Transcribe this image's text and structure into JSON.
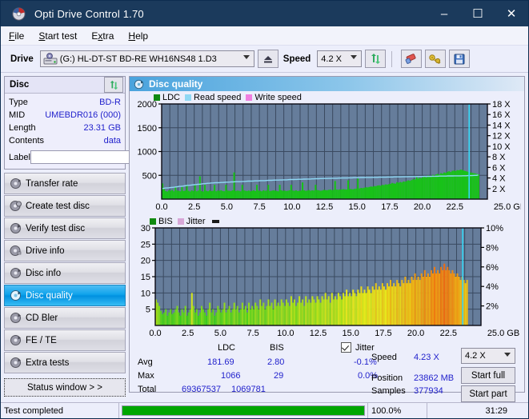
{
  "window": {
    "title": "Opti Drive Control 1.70",
    "icon": "disc-icon",
    "minimize": "–",
    "maximize": "☐",
    "close": "✕",
    "titlebar_color": "#1b3a5c"
  },
  "menu": {
    "items": [
      {
        "label": "File",
        "accel": "F"
      },
      {
        "label": "Start test",
        "accel": "S"
      },
      {
        "label": "Extra",
        "accel": "x"
      },
      {
        "label": "Help",
        "accel": "H"
      }
    ]
  },
  "toolbar": {
    "drive_label": "Drive",
    "drive_value": "(G:)  HL-DT-ST BD-RE  WH16NS48 1.D3",
    "eject_icon": "eject-icon",
    "speed_label": "Speed",
    "speed_value": "4.2 X",
    "refresh_icon": "refresh-icon",
    "erase_icon": "eraser-icon",
    "tools_icon": "key-icon",
    "save_icon": "save-icon"
  },
  "disc": {
    "title": "Disc",
    "refresh_icon": "refresh-icon",
    "rows": [
      {
        "key": "Type",
        "value": "BD-R"
      },
      {
        "key": "MID",
        "value": "UMEBDR016 (000)"
      },
      {
        "key": "Length",
        "value": "23.31 GB"
      },
      {
        "key": "Contents",
        "value": "data"
      }
    ],
    "label_key": "Label",
    "label_value": "",
    "label_placeholder": "",
    "label_button_icon": "cd-icon"
  },
  "nav": {
    "items": [
      {
        "label": "Transfer rate",
        "icon": "disc-icon",
        "selected": false
      },
      {
        "label": "Create test disc",
        "icon": "disc-icon",
        "selected": false
      },
      {
        "label": "Verify test disc",
        "icon": "disc-icon",
        "selected": false
      },
      {
        "label": "Drive info",
        "icon": "disc-icon",
        "selected": false
      },
      {
        "label": "Disc info",
        "icon": "disc-icon",
        "selected": false
      },
      {
        "label": "Disc quality",
        "icon": "disc-icon",
        "selected": true
      },
      {
        "label": "CD Bler",
        "icon": "disc-icon",
        "selected": false
      },
      {
        "label": "FE / TE",
        "icon": "disc-icon",
        "selected": false
      },
      {
        "label": "Extra tests",
        "icon": "disc-icon",
        "selected": false
      }
    ],
    "status_window": "Status window > >"
  },
  "panel": {
    "title": "Disc quality",
    "icon": "disc-icon"
  },
  "stats": {
    "col_ldc": "LDC",
    "col_bis": "BIS",
    "jitter_label": "Jitter",
    "jitter_checked": true,
    "rows": [
      {
        "name": "Avg",
        "ldc": "181.69",
        "bis": "2.80",
        "jitter": "-0.1%"
      },
      {
        "name": "Max",
        "ldc": "1066",
        "bis": "29",
        "jitter": "0.0%"
      },
      {
        "name": "Total",
        "ldc": "69367537",
        "bis": "1069781",
        "jitter": ""
      }
    ],
    "speed_label": "Speed",
    "speed_value": "4.23 X",
    "position_label": "Position",
    "position_value": "23862 MB",
    "samples_label": "Samples",
    "samples_value": "377934",
    "speed_select": "4.2 X",
    "start_full": "Start full",
    "start_part": "Start part"
  },
  "statusbar": {
    "message": "Test completed",
    "progress_text": "100.0%",
    "progress_percent": 100,
    "elapsed": "31:29"
  },
  "chart_data": [
    {
      "type": "area",
      "title": "LDC / Read speed",
      "xlabel": "GB",
      "ylabel": "LDC",
      "xlim": [
        0.0,
        25.0
      ],
      "ylim": [
        0,
        2000
      ],
      "xticks": [
        "0.0",
        "2.5",
        "5.0",
        "7.5",
        "10.0",
        "12.5",
        "15.0",
        "17.5",
        "20.0",
        "22.5",
        "25.0 GB"
      ],
      "yticks": [
        "500",
        "1000",
        "1500",
        "2000"
      ],
      "y2ticks": [
        "2 X",
        "4 X",
        "6 X",
        "8 X",
        "10 X",
        "12 X",
        "14 X",
        "16 X",
        "18 X"
      ],
      "y2lim": [
        0,
        18
      ],
      "grid": true,
      "legend_position": "top-left",
      "legend": [
        {
          "name": "LDC",
          "color": "#18c218"
        },
        {
          "name": "Read speed",
          "color": "#8fd8f4"
        },
        {
          "name": "Write speed",
          "color": "#ef7fe0"
        }
      ],
      "series": [
        {
          "name": "LDC",
          "color": "#18c218",
          "kind": "area",
          "values": [
            330,
            210,
            170,
            160,
            185,
            175,
            195,
            165,
            250,
            180,
            175,
            165,
            255,
            170,
            180,
            300,
            175,
            160,
            185,
            170,
            300,
            165,
            180,
            480,
            170,
            160,
            300,
            175,
            165,
            185,
            170,
            175,
            300,
            165,
            180,
            175,
            185,
            170,
            165,
            300,
            180,
            175,
            170,
            185,
            560,
            170,
            180,
            175,
            165,
            300,
            185,
            175,
            170,
            180,
            165,
            175,
            185,
            170,
            300,
            180,
            175,
            165,
            185,
            175,
            180,
            300,
            170,
            175,
            185,
            180,
            175,
            165,
            300,
            185,
            175,
            180,
            170,
            175,
            185,
            300,
            180,
            175,
            185,
            170,
            175,
            180,
            350,
            185,
            175,
            180,
            190,
            175,
            185,
            180,
            300,
            190,
            185,
            175,
            180,
            195,
            190,
            185,
            195,
            200,
            190,
            195,
            380,
            200,
            195,
            205,
            200,
            210,
            205,
            200,
            395,
            215,
            210,
            205,
            215,
            220,
            430,
            225,
            235,
            230,
            240,
            250,
            245,
            255,
            265,
            260,
            275,
            270,
            285,
            290,
            280,
            300,
            295,
            310,
            305,
            315,
            320,
            340,
            330,
            325,
            355,
            345,
            360,
            350,
            370,
            365,
            380,
            395,
            385,
            400,
            420,
            410,
            470,
            430,
            450,
            440,
            465,
            480,
            455,
            500,
            470,
            490,
            510,
            495,
            520,
            530,
            515,
            545,
            535,
            560,
            550,
            575,
            585,
            570,
            595,
            600,
            590,
            610,
            605,
            620,
            615,
            600,
            590,
            580,
            570,
            560,
            555,
            545,
            540,
            530,
            520,
            0,
            0,
            0,
            0,
            0
          ]
        },
        {
          "name": "Read speed",
          "color": "#8fd8f4",
          "kind": "line",
          "values": [
            2.0,
            2.05,
            2.1,
            2.12,
            2.15,
            2.2,
            2.22,
            2.25,
            2.3,
            2.35,
            2.4,
            2.42,
            2.45,
            2.5,
            2.55,
            2.6,
            2.62,
            2.65,
            2.7,
            2.72,
            2.75,
            2.8,
            2.82,
            2.85,
            2.9,
            2.92,
            2.95,
            3.0,
            3.0,
            3.05,
            3.05,
            3.08,
            3.1,
            3.1,
            3.12,
            3.15,
            3.15,
            3.18,
            3.2,
            3.2,
            3.22,
            3.25,
            3.25,
            3.28,
            3.3,
            3.3,
            3.3,
            3.32,
            3.35,
            3.35,
            3.38,
            3.4,
            3.4,
            3.4,
            3.42,
            3.45,
            3.45,
            3.45,
            3.48,
            3.5,
            3.5,
            3.5,
            3.52,
            3.55,
            3.55,
            3.55,
            3.58,
            3.6,
            3.6,
            3.6,
            3.62,
            3.62,
            3.65,
            3.65,
            3.65,
            3.68,
            3.7,
            3.7,
            3.7,
            3.72,
            3.72,
            3.75,
            3.75,
            3.75,
            3.78,
            3.78,
            3.8,
            3.8,
            3.8,
            3.82,
            3.82,
            3.85,
            3.85,
            3.85,
            3.88,
            3.88,
            3.9,
            3.9,
            3.9,
            3.92,
            3.92,
            3.95,
            3.95,
            3.95,
            3.95,
            3.98,
            3.98,
            4.0,
            4.0,
            4.0,
            4.0,
            4.02,
            4.02,
            4.02,
            4.05,
            4.05,
            4.05,
            4.05,
            4.08,
            4.08,
            4.08,
            4.1,
            4.1,
            4.1,
            4.1,
            4.12,
            4.12,
            4.12,
            4.12,
            4.15,
            4.15,
            4.15,
            4.15,
            4.15,
            4.18,
            4.18,
            4.18,
            4.18,
            4.2,
            4.2,
            4.2,
            4.2,
            4.2,
            4.22,
            4.22,
            4.22,
            4.22,
            4.25,
            4.25,
            4.25,
            4.25,
            4.25,
            4.28,
            4.28,
            4.28,
            4.28,
            4.3,
            4.3,
            4.3,
            4.3,
            4.3,
            4.32,
            4.32,
            4.32,
            4.32,
            4.35,
            4.35,
            4.35,
            4.35,
            4.35,
            4.38,
            4.38,
            4.38,
            4.38,
            4.4,
            4.4,
            4.4,
            4.4,
            4.4,
            4.42,
            4.42,
            4.42,
            4.45,
            4.45,
            4.45,
            4.48,
            4.5,
            4.5,
            4.55,
            0,
            0,
            0,
            0,
            0
          ]
        }
      ],
      "marker_line": {
        "x": 23.6,
        "color": "#35d6f4"
      }
    },
    {
      "type": "area",
      "title": "BIS / Jitter",
      "xlabel": "GB",
      "ylabel": "BIS",
      "xlim": [
        0.0,
        25.0
      ],
      "ylim": [
        0,
        30
      ],
      "xticks": [
        "0.0",
        "2.5",
        "5.0",
        "7.5",
        "10.0",
        "12.5",
        "15.0",
        "17.5",
        "20.0",
        "22.5",
        "25.0 GB"
      ],
      "yticks": [
        "5",
        "10",
        "15",
        "20",
        "25",
        "30"
      ],
      "y2ticks": [
        "2%",
        "4%",
        "6%",
        "8%",
        "10%"
      ],
      "y2lim": [
        0,
        10
      ],
      "grid": true,
      "legend_position": "top-left",
      "legend": [
        {
          "name": "BIS",
          "color": "#18c218"
        },
        {
          "name": "Jitter",
          "color": "#d8a8d8"
        }
      ],
      "series": [
        {
          "name": "BIS",
          "color": "#18c218",
          "kind": "area",
          "values": [
            8,
            7,
            6,
            4.5,
            3.5,
            4,
            5,
            3,
            4,
            5,
            3.5,
            4,
            5,
            6,
            4,
            3,
            5,
            4,
            6,
            3,
            4,
            5,
            10,
            6,
            4,
            5,
            3,
            4,
            6,
            5,
            4,
            3,
            5,
            7,
            4,
            5,
            3,
            4,
            6,
            5,
            4,
            5,
            7,
            4,
            5,
            6,
            4,
            5,
            7,
            5,
            6,
            4,
            5,
            7,
            5,
            6,
            4,
            7,
            5,
            6,
            5,
            7,
            6,
            5,
            8,
            6,
            7,
            5,
            6,
            8,
            6,
            7,
            5,
            8,
            6,
            7,
            6,
            8,
            7,
            6,
            8,
            7,
            6,
            9,
            7,
            8,
            6,
            7,
            9,
            7,
            8,
            6,
            9,
            7,
            8,
            7,
            9,
            8,
            7,
            9,
            8,
            7,
            9,
            8,
            10,
            8,
            9,
            7,
            10,
            8,
            9,
            8,
            10,
            9,
            8,
            10,
            9,
            11,
            9,
            10,
            9,
            11,
            10,
            9,
            11,
            10,
            12,
            10,
            11,
            10,
            12,
            11,
            10,
            12,
            11,
            13,
            11,
            12,
            11,
            13,
            12,
            11,
            13,
            12,
            14,
            12,
            13,
            12,
            14,
            13,
            12,
            14,
            13,
            15,
            13,
            14,
            13,
            15,
            14,
            16,
            14,
            15,
            14,
            16,
            15,
            17,
            15,
            16,
            15,
            17,
            16,
            18,
            16,
            17,
            16,
            18,
            17,
            19,
            17,
            18,
            17,
            16,
            17,
            16,
            15,
            16,
            15,
            14,
            15,
            14,
            13,
            14,
            0,
            0,
            0,
            0,
            0,
            0,
            0,
            0
          ]
        },
        {
          "name": "Jitter",
          "color": "#d8a8d8",
          "kind": "line",
          "values": []
        }
      ],
      "marker_line": {
        "x": 23.6,
        "color": "#35d6f4"
      }
    }
  ]
}
